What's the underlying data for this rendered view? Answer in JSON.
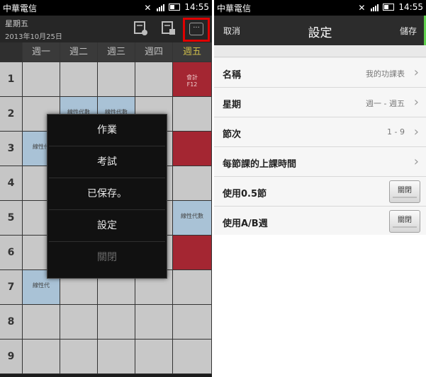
{
  "left": {
    "statusbar": {
      "carrier": "中華電信",
      "time": "14:55"
    },
    "header": {
      "day": "星期五",
      "date": "2013年10月25日"
    },
    "days": [
      "週一",
      "週二",
      "週三",
      "週四",
      "週五"
    ],
    "periods": [
      "1",
      "2",
      "3",
      "4",
      "5",
      "6",
      "7",
      "8",
      "9"
    ],
    "courses": {
      "accounting": "會計\nF12",
      "linear_algebra": "線性代數",
      "linear_algebra_short": "線性代"
    },
    "menu": {
      "items": [
        "作業",
        "考試",
        "已保存。",
        "設定",
        "關閉"
      ]
    }
  },
  "right": {
    "statusbar": {
      "carrier": "中華電信",
      "time": "14:55"
    },
    "header": {
      "cancel": "取消",
      "title": "設定",
      "save": "儲存"
    },
    "rows": [
      {
        "label": "名稱",
        "value": "我的功課表"
      },
      {
        "label": "星期",
        "value": "週一 - 週五"
      },
      {
        "label": "節次",
        "value": "1 - 9"
      },
      {
        "label": "每節課的上課時間",
        "value": ""
      },
      {
        "label": "使用0.5節",
        "toggle": "關閉"
      },
      {
        "label": "使用A/B週",
        "toggle": "關閉"
      }
    ]
  },
  "colors": {
    "accent_green": "#5fd04c",
    "highlight_red": "#e00000",
    "course_red": "#a42632",
    "course_blue": "#a9c2d6"
  },
  "icons": [
    "signal-icon",
    "battery-icon",
    "add-note-icon",
    "edit-note-icon",
    "more-icon",
    "chevron-right-icon"
  ]
}
